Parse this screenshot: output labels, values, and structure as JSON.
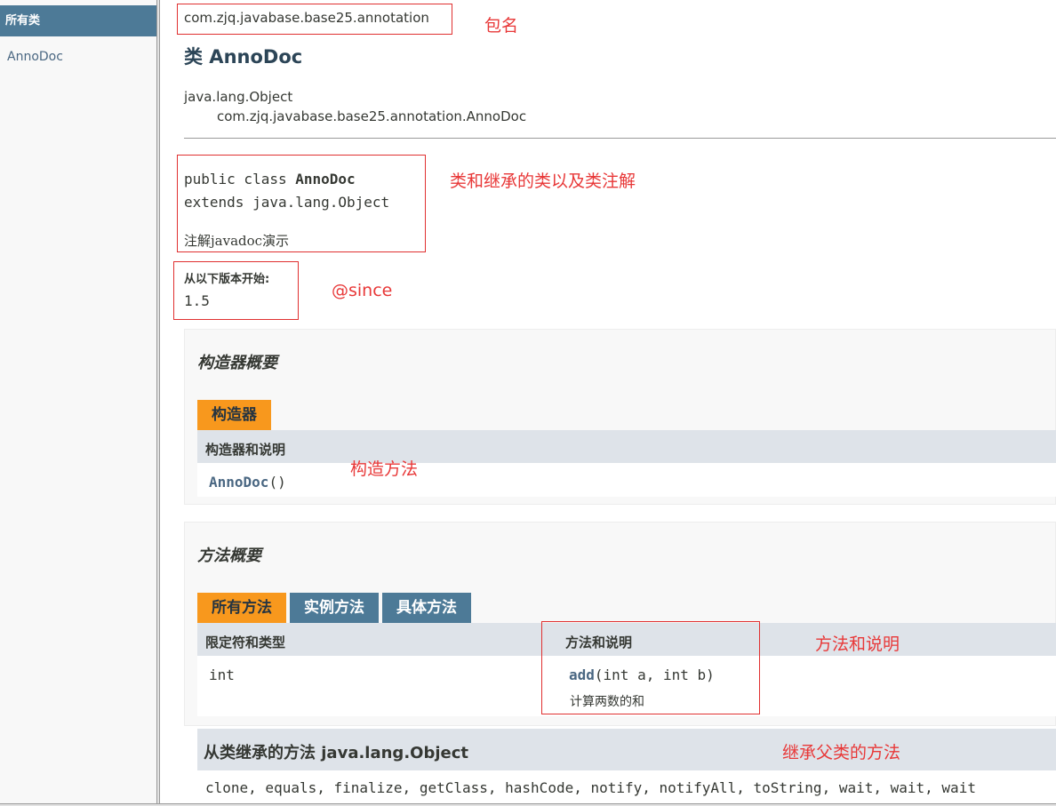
{
  "left_frame": {
    "header": "所有类",
    "link": "AnnoDoc"
  },
  "package_name": "com.zjq.javabase.base25.annotation",
  "class_title": "类 AnnoDoc",
  "inheritance": {
    "root": "java.lang.Object",
    "child": "com.zjq.javabase.base25.annotation.AnnoDoc"
  },
  "declaration": {
    "line1_prefix": "public class ",
    "line1_name": "AnnoDoc",
    "line2": "extends java.lang.Object",
    "description": "注解javadoc演示"
  },
  "since": {
    "label": "从以下版本开始:",
    "value": "1.5"
  },
  "constructor_summary": {
    "title": "构造器概要",
    "tab": "构造器",
    "header": "构造器和说明",
    "constructor_name": "AnnoDoc",
    "constructor_params": "()"
  },
  "method_summary": {
    "title": "方法概要",
    "tabs": [
      "所有方法",
      "实例方法",
      "具体方法"
    ],
    "headers": {
      "modifier": "限定符和类型",
      "method": "方法和说明"
    },
    "rows": [
      {
        "type": "int",
        "name": "add",
        "params": "(int a, int b)",
        "desc": "计算两数的和"
      }
    ]
  },
  "inherited": {
    "title": "从类继承的方法 java.lang.Object",
    "methods": "clone, equals, finalize, getClass, hashCode, notify, notifyAll, toString, wait, wait, wait"
  },
  "annotations": {
    "package": "包名",
    "class": "类和继承的类以及类注解",
    "since": "@since",
    "constructor": "构造方法",
    "method": "方法和说明",
    "inherited": "继承父类的方法"
  },
  "colors": {
    "nav_blue": "#4d7a97",
    "tab_orange": "#f8981d",
    "annotation_red": "#e83838"
  }
}
